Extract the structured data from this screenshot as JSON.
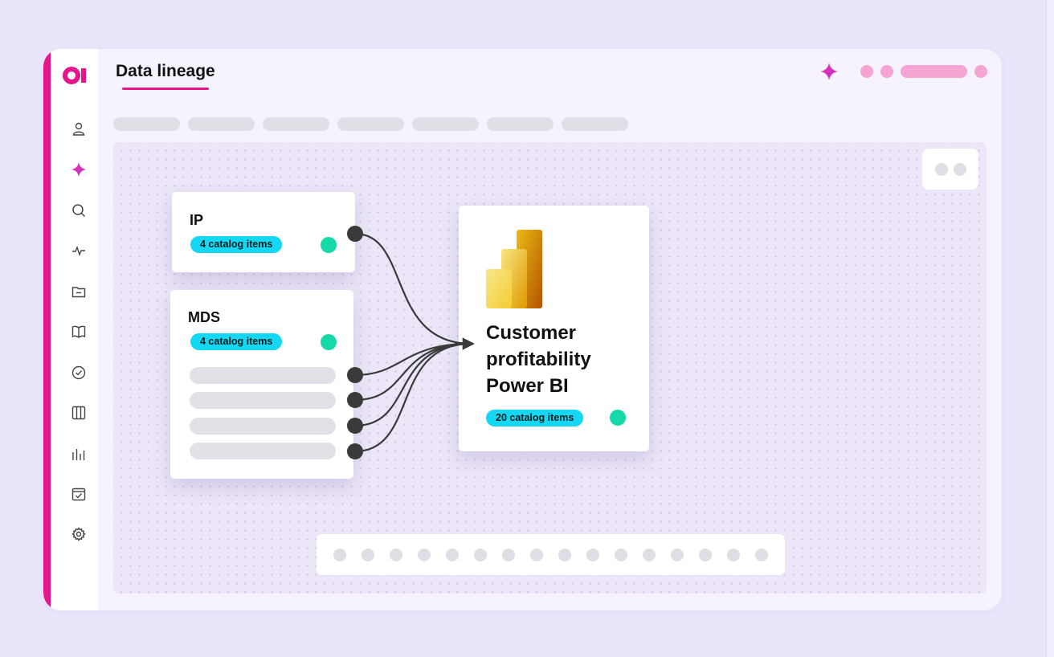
{
  "header": {
    "title": "Data lineage"
  },
  "sidebar": {
    "items": [
      {
        "icon": "user-icon"
      },
      {
        "icon": "sparkle-icon",
        "active": true
      },
      {
        "icon": "search-icon"
      },
      {
        "icon": "activity-icon"
      },
      {
        "icon": "folder-icon"
      },
      {
        "icon": "book-icon"
      },
      {
        "icon": "check-circle-icon"
      },
      {
        "icon": "columns-icon"
      },
      {
        "icon": "bar-chart-icon"
      },
      {
        "icon": "calendar-check-icon"
      },
      {
        "icon": "settings-icon"
      }
    ]
  },
  "nodes": {
    "ip": {
      "title": "IP",
      "badge": "4 catalog items"
    },
    "mds": {
      "title": "MDS",
      "badge": "4 catalog items"
    },
    "powerbi": {
      "title": "Customer profitability Power BI",
      "badge": "20 catalog items"
    }
  },
  "colors": {
    "accent": "#e5168a",
    "badge": "#14d7f3",
    "status": "#17d8a9",
    "connector": "#3a3a3a"
  }
}
